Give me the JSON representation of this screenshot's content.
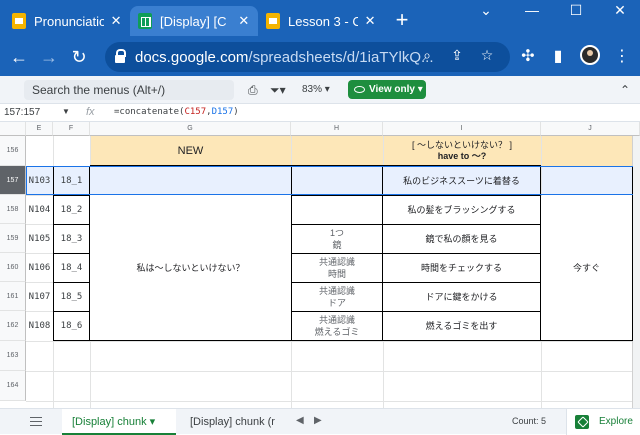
{
  "browser": {
    "tabs": [
      {
        "label": "Pronunciation",
        "icon": "slides-icon"
      },
      {
        "label": "[Display] [C",
        "icon": "sheets-icon"
      },
      {
        "label": "Lesson 3 - C",
        "icon": "slides-icon"
      }
    ],
    "new_tab": "+",
    "window_controls": {
      "collapse": "⌄",
      "minimize": "—",
      "maximize": "☐",
      "close": "✕"
    },
    "url_host": "docs.google.com",
    "url_path": "/spreadsheets/d/1iaTYlkQ..."
  },
  "toolbar": {
    "menu_search_placeholder": "Search the menus (Alt+/)",
    "zoom": "83%",
    "view_only_label": "View only"
  },
  "formula_bar": {
    "name_box": "157:157",
    "fx": "fx",
    "formula_prefix": "=concatenate(",
    "ref1": "C157",
    "sep": ",",
    "ref2": "D157",
    "formula_suffix": ")"
  },
  "grid": {
    "columns": [
      "E",
      "F",
      "G",
      "H",
      "I",
      "J"
    ],
    "rows": [
      "156",
      "157",
      "158",
      "159",
      "160",
      "161",
      "162",
      "163",
      "164"
    ],
    "header_row": {
      "new": "NEW",
      "grammar_line1": "[ 〜しないといけない？ ]",
      "grammar_line2": "have to ～?"
    },
    "ids": [
      "N103",
      "N104",
      "N105",
      "N106",
      "N107",
      "N108"
    ],
    "chunks": [
      "18_1",
      "18_2",
      "18_3",
      "18_4",
      "18_5",
      "18_6"
    ],
    "merged_g": "私は〜しないといけない？",
    "words": [
      "",
      "",
      "1つ\n鏡",
      "共通認識\n時間",
      "共通認識\nドア",
      "共通認識\n燃えるゴミ"
    ],
    "sentences": [
      "私のビジネススーツに着替る",
      "私の髪をブラッシングする",
      "鏡で私の顔を見る",
      "時間をチェックする",
      "ドアに鍵をかける",
      "燃えるゴミを出す"
    ],
    "merged_j": "今すぐ"
  },
  "sheetbar": {
    "tabs": [
      "[Display] chunk",
      "[Display] chunk (r"
    ],
    "count": "Count: 5",
    "explore": "Explore"
  }
}
